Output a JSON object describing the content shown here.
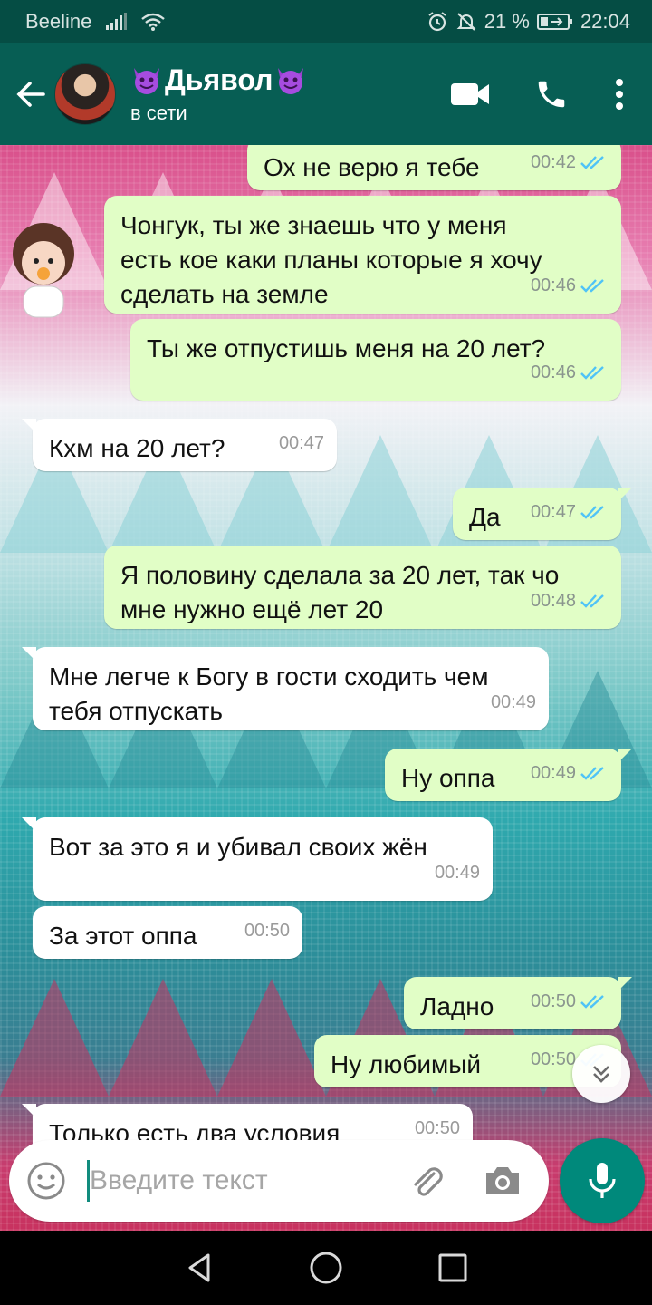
{
  "status_bar": {
    "carrier": "Beeline",
    "battery": "21 %",
    "time": "22:04"
  },
  "header": {
    "contact_name": "Дьявол",
    "contact_status": "в сети"
  },
  "colors": {
    "header": "#075e54",
    "status_bar": "#054d44",
    "outgoing_bubble": "#e1fec6",
    "incoming_bubble": "#ffffff",
    "accent": "#00897b",
    "read_ticks": "#4fc3f7"
  },
  "messages": [
    {
      "direction": "out",
      "text": "Ох не верю я тебе",
      "time": "00:42",
      "status": "read"
    },
    {
      "direction": "out",
      "text": "Чонгук, ты же знаешь что у меня есть кое каки планы которые я хочу сделать на земле",
      "time": "00:46",
      "status": "read"
    },
    {
      "direction": "out",
      "text": "Ты же отпустишь меня на 20 лет?",
      "time": "00:46",
      "status": "read"
    },
    {
      "direction": "in",
      "text": "Кхм на 20 лет?",
      "time": "00:47"
    },
    {
      "direction": "out",
      "text": "Да",
      "time": "00:47",
      "status": "read"
    },
    {
      "direction": "out",
      "text": "Я половину сделала за 20 лет, так чо мне нужно ещё лет 20",
      "time": "00:48",
      "status": "read"
    },
    {
      "direction": "in",
      "text": "Мне легче к Богу в гости сходить чем тебя отпускать",
      "time": "00:49"
    },
    {
      "direction": "out",
      "text": "Ну оппа",
      "time": "00:49",
      "status": "read"
    },
    {
      "direction": "in",
      "text": "Вот за это я и убивал своих жён",
      "time": "00:49"
    },
    {
      "direction": "in",
      "text": "За этот оппа",
      "time": "00:50"
    },
    {
      "direction": "out",
      "text": "Ладно",
      "time": "00:50",
      "status": "read"
    },
    {
      "direction": "out",
      "text": "Ну любимый",
      "time": "00:50",
      "status": "read"
    },
    {
      "direction": "in",
      "text": "Только есть два условия",
      "time": "00:50"
    }
  ],
  "composer": {
    "placeholder": "Введите текст"
  },
  "icons": {
    "back": "arrow-left-icon",
    "video": "video-camera-icon",
    "call": "phone-icon",
    "menu": "more-vert-icon",
    "emoji": "emoji-icon",
    "attach": "paperclip-icon",
    "camera": "camera-icon",
    "mic": "microphone-icon",
    "scroll": "chevron-double-down-icon"
  }
}
